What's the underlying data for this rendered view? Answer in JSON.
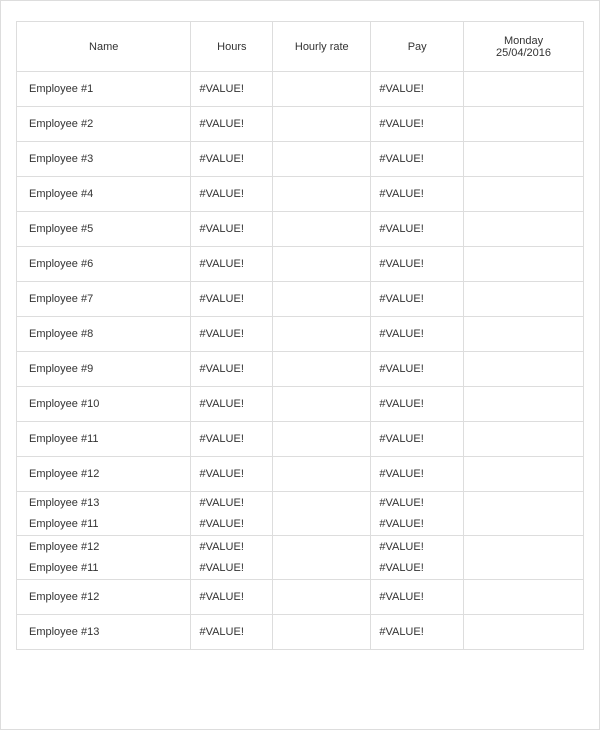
{
  "headers": {
    "name": "Name",
    "hours": "Hours",
    "rate": "Hourly rate",
    "pay": "Pay",
    "date_line1": "Monday",
    "date_line2": "25/04/2016"
  },
  "rows": [
    {
      "name": "Employee #1",
      "hours": "#VALUE!",
      "rate": "",
      "pay": "#VALUE!",
      "date": "",
      "group": 0
    },
    {
      "name": "Employee #2",
      "hours": "#VALUE!",
      "rate": "",
      "pay": "#VALUE!",
      "date": "",
      "group": 0
    },
    {
      "name": "Employee #3",
      "hours": "#VALUE!",
      "rate": "",
      "pay": "#VALUE!",
      "date": "",
      "group": 0
    },
    {
      "name": "Employee #4",
      "hours": "#VALUE!",
      "rate": "",
      "pay": "#VALUE!",
      "date": "",
      "group": 0
    },
    {
      "name": "Employee #5",
      "hours": "#VALUE!",
      "rate": "",
      "pay": "#VALUE!",
      "date": "",
      "group": 0
    },
    {
      "name": "Employee #6",
      "hours": "#VALUE!",
      "rate": "",
      "pay": "#VALUE!",
      "date": "",
      "group": 0
    },
    {
      "name": "Employee #7",
      "hours": "#VALUE!",
      "rate": "",
      "pay": "#VALUE!",
      "date": "",
      "group": 0
    },
    {
      "name": "Employee #8",
      "hours": "#VALUE!",
      "rate": "",
      "pay": "#VALUE!",
      "date": "",
      "group": 0
    },
    {
      "name": "Employee #9",
      "hours": "#VALUE!",
      "rate": "",
      "pay": "#VALUE!",
      "date": "",
      "group": 0
    },
    {
      "name": "Employee #10",
      "hours": "#VALUE!",
      "rate": "",
      "pay": "#VALUE!",
      "date": "",
      "group": 0
    },
    {
      "name": "Employee #11",
      "hours": "#VALUE!",
      "rate": "",
      "pay": "#VALUE!",
      "date": "",
      "group": 0
    },
    {
      "name": "Employee #12",
      "hours": "#VALUE!",
      "rate": "",
      "pay": "#VALUE!",
      "date": "",
      "group": 0
    },
    {
      "name": "Employee #13",
      "hours": "#VALUE!",
      "rate": "",
      "pay": "#VALUE!",
      "date": "",
      "group": 1
    },
    {
      "name": "Employee #11",
      "hours": "#VALUE!",
      "rate": "",
      "pay": "#VALUE!",
      "date": "",
      "group": 2
    },
    {
      "name": "Employee #12",
      "hours": "#VALUE!",
      "rate": "",
      "pay": "#VALUE!",
      "date": "",
      "group": 1
    },
    {
      "name": "Employee #11",
      "hours": "#VALUE!",
      "rate": "",
      "pay": "#VALUE!",
      "date": "",
      "group": 2
    },
    {
      "name": "Employee #12",
      "hours": "#VALUE!",
      "rate": "",
      "pay": "#VALUE!",
      "date": "",
      "group": 0
    },
    {
      "name": "Employee #13",
      "hours": "#VALUE!",
      "rate": "",
      "pay": "#VALUE!",
      "date": "",
      "group": 0
    }
  ]
}
